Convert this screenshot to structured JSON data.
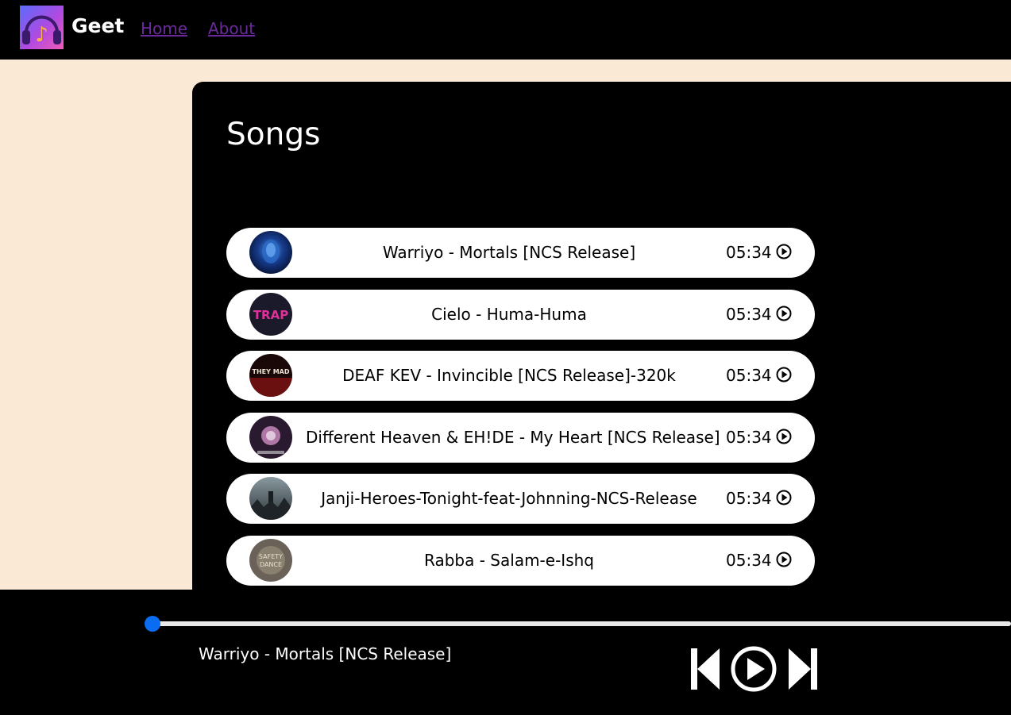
{
  "nav": {
    "brand": "Geet",
    "links": [
      "Home",
      "About"
    ],
    "logo_icon": "headphones-music-icon"
  },
  "main": {
    "title": "Songs",
    "songs": [
      {
        "name": "Warriyo - Mortals [NCS Release]",
        "time": "05:34",
        "cover": "blue-face-cover"
      },
      {
        "name": "Cielo - Huma-Huma",
        "time": "05:34",
        "cover": "pink-trap-cover"
      },
      {
        "name": "DEAF KEV - Invincible [NCS Release]-320k",
        "time": "05:34",
        "cover": "red-dark-cover"
      },
      {
        "name": "Different Heaven & EH!DE - My Heart [NCS Release]",
        "time": "05:34",
        "cover": "pink-figure-cover"
      },
      {
        "name": "Janji-Heroes-Tonight-feat-Johnning-NCS-Release",
        "time": "05:34",
        "cover": "grey-forest-cover"
      },
      {
        "name": "Rabba - Salam-e-Ishq",
        "time": "05:34",
        "cover": "sepia-safety-dance-cover"
      }
    ]
  },
  "player": {
    "now_playing": "Warriyo - Mortals [NCS Release]",
    "progress": 0,
    "controls": [
      "previous-icon",
      "play-icon",
      "next-icon"
    ],
    "accent_color": "#0a6cf0"
  },
  "colors": {
    "background": "#fae9d4",
    "panel": "#000000",
    "link": "#6a2a9c"
  }
}
